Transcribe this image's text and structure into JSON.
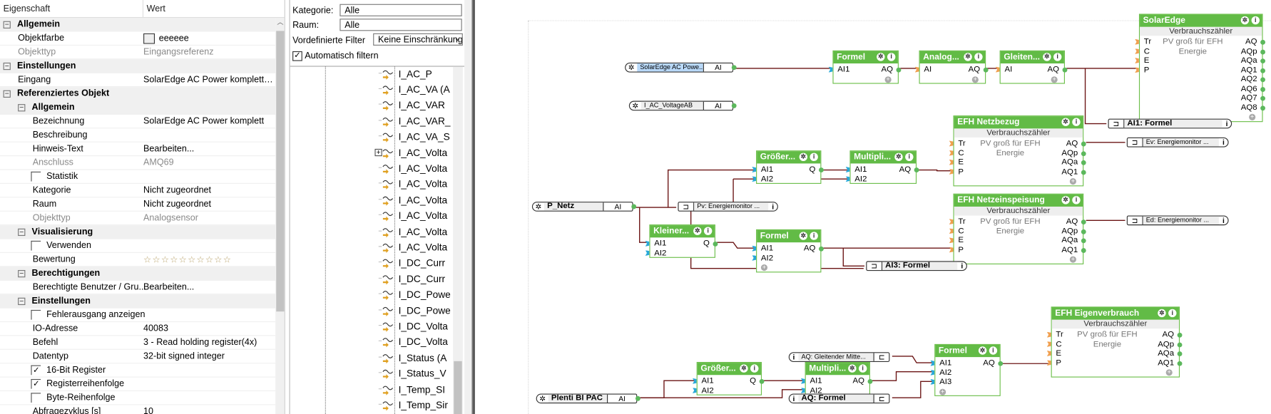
{
  "properties": {
    "header": {
      "name": "Eigenschaft",
      "value": "Wert"
    },
    "rows": [
      {
        "type": "section",
        "level": 0,
        "label": "Allgemein"
      },
      {
        "type": "prop",
        "level": 1,
        "label": "Objektfarbe",
        "value": "eeeeee",
        "swatch": "#eeeeee"
      },
      {
        "type": "prop",
        "level": 1,
        "label": "Objekttyp",
        "value": "Eingangsreferenz",
        "readonly": true
      },
      {
        "type": "section",
        "level": 0,
        "label": "Einstellungen"
      },
      {
        "type": "prop",
        "level": 1,
        "label": "Eingang",
        "value": "SolarEdge AC Power komplett (..."
      },
      {
        "type": "section",
        "level": 0,
        "label": "Referenziertes Objekt"
      },
      {
        "type": "section",
        "level": 1,
        "label": "Allgemein"
      },
      {
        "type": "prop",
        "level": 2,
        "label": "Bezeichnung",
        "value": "SolarEdge AC Power komplett"
      },
      {
        "type": "prop",
        "level": 2,
        "label": "Beschreibung",
        "value": ""
      },
      {
        "type": "prop",
        "level": 2,
        "label": "Hinweis-Text",
        "value": "Bearbeiten..."
      },
      {
        "type": "prop",
        "level": 2,
        "label": "Anschluss",
        "value": "AMQ69",
        "readonly": true
      },
      {
        "type": "check",
        "level": 2,
        "label": "Statistik",
        "checked": false
      },
      {
        "type": "prop",
        "level": 2,
        "label": "Kategorie",
        "value": "Nicht zugeordnet"
      },
      {
        "type": "prop",
        "level": 2,
        "label": "Raum",
        "value": "Nicht zugeordnet"
      },
      {
        "type": "prop",
        "level": 2,
        "label": "Objekttyp",
        "value": "Analogsensor",
        "readonly": true
      },
      {
        "type": "section",
        "level": 1,
        "label": "Visualisierung"
      },
      {
        "type": "check",
        "level": 2,
        "label": "Verwenden",
        "checked": false
      },
      {
        "type": "rating",
        "level": 2,
        "label": "Bewertung",
        "value": "☆☆☆☆☆☆☆☆☆☆",
        "stars": 0
      },
      {
        "type": "section",
        "level": 1,
        "label": "Berechtigungen"
      },
      {
        "type": "prop",
        "level": 2,
        "label": "Berechtigte Benutzer / Gru...",
        "value": "Bearbeiten..."
      },
      {
        "type": "section",
        "level": 1,
        "label": "Einstellungen"
      },
      {
        "type": "check",
        "level": 2,
        "label": "Fehlerausgang anzeigen",
        "checked": false
      },
      {
        "type": "prop",
        "level": 2,
        "label": "IO-Adresse",
        "value": "40083"
      },
      {
        "type": "prop",
        "level": 2,
        "label": "Befehl",
        "value": "3 - Read holding register(4x)"
      },
      {
        "type": "prop",
        "level": 2,
        "label": "Datentyp",
        "value": "32-bit signed integer"
      },
      {
        "type": "check",
        "level": 2,
        "label": "16-Bit Register",
        "checked": true
      },
      {
        "type": "check",
        "level": 2,
        "label": "Registerreihenfolge",
        "checked": true
      },
      {
        "type": "check",
        "level": 2,
        "label": "Byte-Reihenfolge",
        "checked": false
      },
      {
        "type": "prop",
        "level": 2,
        "label": "Abfragezyklus [s]",
        "value": "10"
      }
    ]
  },
  "filter": {
    "kategorie_label": "Kategorie:",
    "kategorie_value": "Alle",
    "raum_label": "Raum:",
    "raum_value": "Alle",
    "predef_label": "Vordefinierte Filter",
    "predef_value": "Keine Einschränkunge",
    "auto_label": "Automatisch filtern",
    "auto_checked": true
  },
  "tree": {
    "items": [
      "I_AC_P",
      "I_AC_VA (A",
      "I_AC_VAR",
      "I_AC_VAR_",
      "I_AC_VA_S",
      "I_AC_Volta",
      "I_AC_Volta",
      "I_AC_Volta",
      "I_AC_Volta",
      "I_AC_Volta",
      "I_AC_Volta",
      "I_AC_Volta",
      "I_DC_Curr",
      "I_DC_Curr",
      "I_DC_Powe",
      "I_DC_Powe",
      "I_DC_Volta",
      "I_DC_Volta",
      "I_Status (A",
      "I_Status_V",
      "I_Temp_SI",
      "I_Temp_Sir"
    ]
  },
  "diagram": {
    "colors": {
      "block": "#62bb46",
      "wire": "#6b1414",
      "input_analog": "#29a8d8",
      "input_other": "#f0a050",
      "output": "#5cb85c"
    },
    "inputs": [
      {
        "id": "in1",
        "label": "SolarEdge  AC  Powe...",
        "port": "AI",
        "selected": true
      },
      {
        "id": "in2",
        "label": "I_AC_VoltageAB",
        "port": "AI"
      },
      {
        "id": "in3",
        "label": "P_Netz",
        "port": "AI"
      },
      {
        "id": "in4",
        "label": "Plenti BI PAC",
        "port": "AI"
      }
    ],
    "refs": [
      {
        "id": "r1",
        "label": "AI1: Formel",
        "dir": "out"
      },
      {
        "id": "r2",
        "label": "Ev:  Energiemonitor ...",
        "dir": "out"
      },
      {
        "id": "r3",
        "label": "Pv:  Energiemonitor ...",
        "dir": "out"
      },
      {
        "id": "r4",
        "label": "Ed:  Energiemonitor ...",
        "dir": "out"
      },
      {
        "id": "r5",
        "label": "AI3: Formel",
        "dir": "out"
      },
      {
        "id": "r6",
        "label": "AQ:  Gleitender  Mitte...",
        "dir": "in"
      },
      {
        "id": "r7",
        "label": "AQ: Formel",
        "dir": "in"
      }
    ],
    "blocks": [
      {
        "id": "b1",
        "title": "Formel",
        "in": [
          "AI1"
        ],
        "out": [
          "AQ"
        ],
        "pin": "analog"
      },
      {
        "id": "b2",
        "title": "Analog...",
        "in": [
          "AI"
        ],
        "out": [
          "AQ"
        ],
        "pin": "other"
      },
      {
        "id": "b3",
        "title": "Gleiten...",
        "in": [
          "AI"
        ],
        "out": [
          "AQ"
        ],
        "pin": "other"
      },
      {
        "id": "b4",
        "title": "SolarEdge",
        "sub": "Verbrauchszähler",
        "desc": [
          "PV groß für EFH",
          "Energie"
        ],
        "in": [
          "Tr",
          "C",
          "E",
          "P"
        ],
        "out": [
          "AQ",
          "AQp",
          "AQa",
          "AQ1",
          "AQ2",
          "AQ6",
          "AQ7",
          "AQ8"
        ],
        "pin": "other"
      },
      {
        "id": "b5",
        "title": "EFH Netzbezug",
        "sub": "Verbrauchszähler",
        "desc": [
          "PV groß für EFH",
          "Energie"
        ],
        "in": [
          "Tr",
          "C",
          "E",
          "P"
        ],
        "out": [
          "AQ",
          "AQp",
          "AQa",
          "AQ1"
        ],
        "pin": "other"
      },
      {
        "id": "b6",
        "title": "Größer...",
        "in": [
          "AI1",
          "AI2"
        ],
        "out": [
          "Q"
        ],
        "pin": "analog",
        "noplus": true
      },
      {
        "id": "b7",
        "title": "Multipli...",
        "in": [
          "AI1",
          "AI2"
        ],
        "out": [
          "AQ"
        ],
        "pin": "analog",
        "noplus": true
      },
      {
        "id": "b8",
        "title": "EFH Netzeinspeisung",
        "sub": "Verbrauchszähler",
        "desc": [
          "PV groß für EFH",
          "Energie"
        ],
        "in": [
          "Tr",
          "C",
          "E",
          "P"
        ],
        "out": [
          "AQ",
          "AQp",
          "AQa",
          "AQ1"
        ],
        "pin": "other"
      },
      {
        "id": "b9",
        "title": "Kleiner...",
        "in": [
          "AI1",
          "AI2"
        ],
        "out": [
          "Q"
        ],
        "pin": "analog",
        "noplus": true
      },
      {
        "id": "b10",
        "title": "Formel",
        "in": [
          "AI1",
          "AI2"
        ],
        "out": [
          "AQ"
        ],
        "pin": "analog"
      },
      {
        "id": "b11",
        "title": "EFH Eigenverbrauch",
        "sub": "Verbrauchszähler",
        "desc": [
          "PV groß für EFH",
          "Energie"
        ],
        "in": [
          "Tr",
          "C",
          "E",
          "P"
        ],
        "out": [
          "AQ",
          "AQp",
          "AQa",
          "AQ1"
        ],
        "pin": "other"
      },
      {
        "id": "b12",
        "title": "Formel",
        "in": [
          "AI1",
          "AI2",
          "AI3"
        ],
        "out": [
          "AQ"
        ],
        "pin": "analog"
      },
      {
        "id": "b13",
        "title": "Größer...",
        "in": [
          "AI1",
          "AI2"
        ],
        "out": [
          "Q"
        ],
        "pin": "analog",
        "noplus": true
      },
      {
        "id": "b14",
        "title": "Multipli...",
        "in": [
          "AI1",
          "AI2"
        ],
        "out": [
          "AQ"
        ],
        "pin": "analog",
        "noplus": true
      }
    ]
  }
}
